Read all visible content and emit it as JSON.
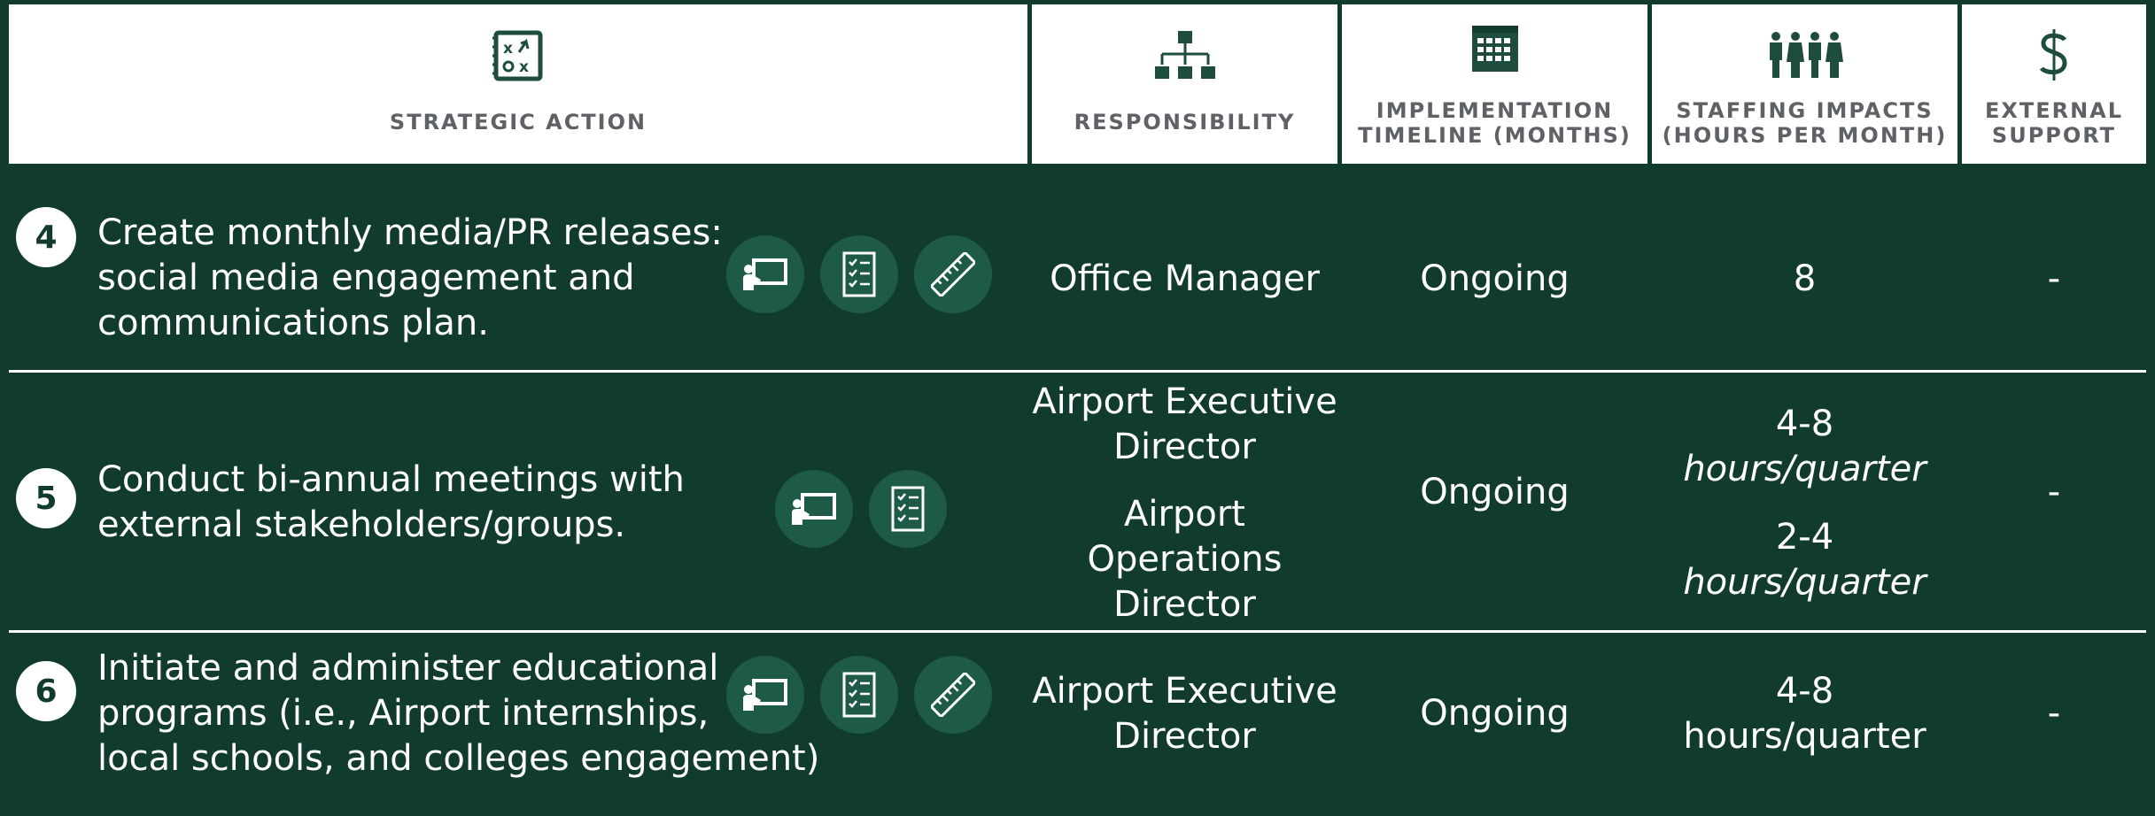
{
  "header": {
    "strategic_action": "STRATEGIC ACTION",
    "responsibility": "RESPONSIBILITY",
    "timeline": "IMPLEMENTATION\nTIMELINE (MONTHS)",
    "staffing": "STAFFING IMPACTS\n(HOURS PER MONTH)",
    "external": "EXTERNAL\nSUPPORT",
    "icons": [
      "strategy-icon",
      "org-chart-icon",
      "calendar-icon",
      "people-icon",
      "dollar-icon"
    ]
  },
  "colors": {
    "background": "#123b30",
    "icon_circle": "#1e5a48",
    "header_text": "#5e6266",
    "number_text": "#123b30"
  },
  "rows": [
    {
      "number": "4",
      "action_lines": [
        "Create monthly media/PR releases:",
        "social media engagement and",
        "communications plan."
      ],
      "icons": [
        "presentation-icon",
        "checklist-icon",
        "ruler-icon"
      ],
      "responsibility": [
        "Office Manager"
      ],
      "timeline": "Ongoing",
      "staffing": [
        "8"
      ],
      "external": "-"
    },
    {
      "number": "5",
      "action_lines": [
        "Conduct bi-annual meetings with",
        "external stakeholders/groups."
      ],
      "icons": [
        "presentation-icon",
        "checklist-icon"
      ],
      "responsibility": [
        "Airport Executive",
        "Director",
        "Airport",
        "Operations",
        "Director"
      ],
      "timeline": "Ongoing",
      "staffing": [
        "4-8",
        "hours/quarter",
        "2-4",
        "hours/quarter"
      ],
      "external": "-"
    },
    {
      "number": "6",
      "action_lines": [
        "Initiate and administer educational",
        "programs (i.e., Airport internships,",
        "local schools, and colleges engagement)"
      ],
      "icons": [
        "presentation-icon",
        "checklist-icon",
        "ruler-icon"
      ],
      "responsibility": [
        "Airport Executive",
        "Director"
      ],
      "timeline": "Ongoing",
      "staffing": [
        "4-8",
        "hours/quarter"
      ],
      "external": "-"
    }
  ]
}
